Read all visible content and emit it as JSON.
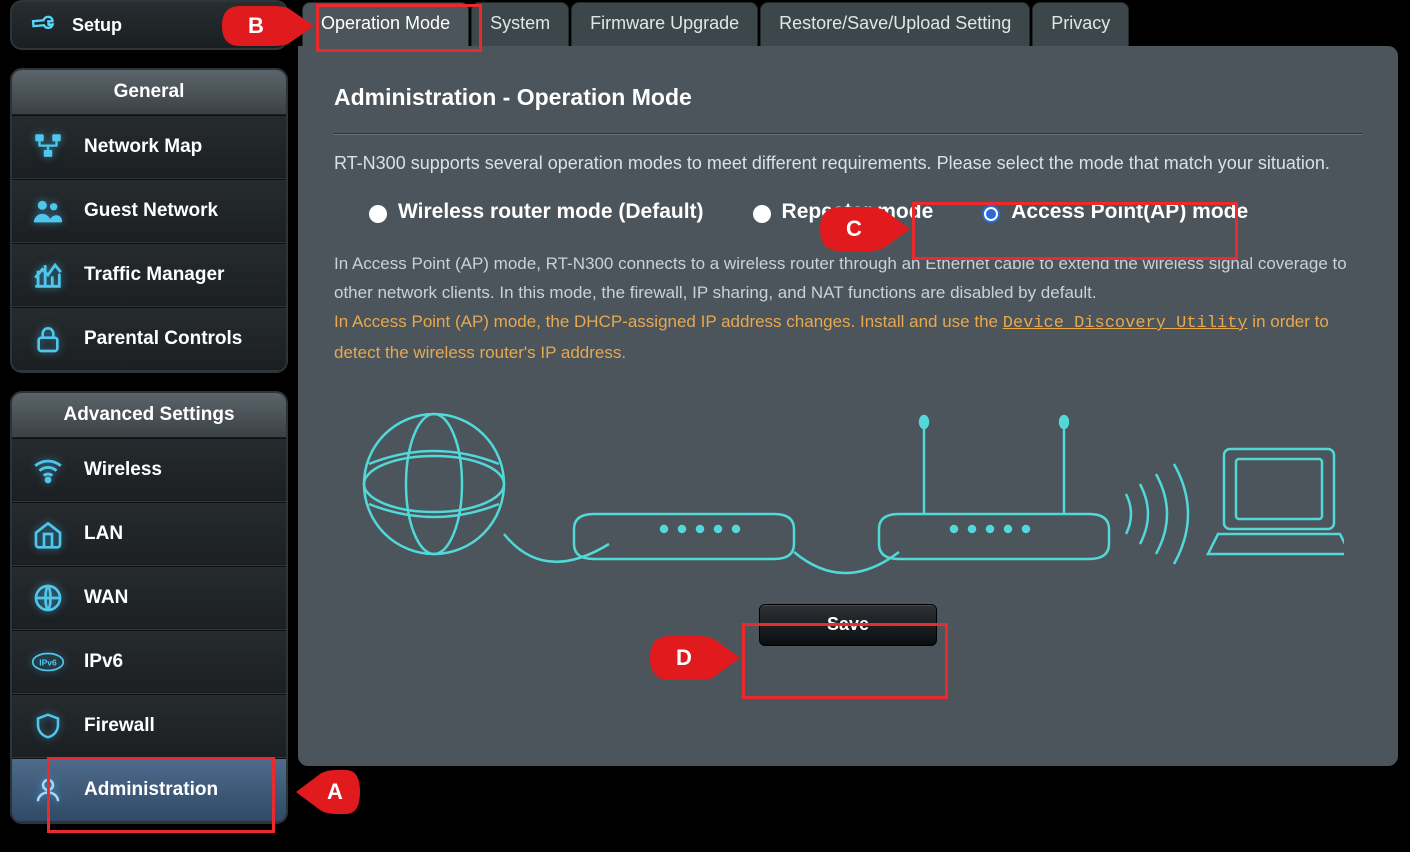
{
  "sidebar": {
    "setup_label": "Setup",
    "general_title": "General",
    "general_items": [
      {
        "label": "Network Map"
      },
      {
        "label": "Guest Network"
      },
      {
        "label": "Traffic Manager"
      },
      {
        "label": "Parental Controls"
      }
    ],
    "advanced_title": "Advanced Settings",
    "advanced_items": [
      {
        "label": "Wireless"
      },
      {
        "label": "LAN"
      },
      {
        "label": "WAN"
      },
      {
        "label": "IPv6"
      },
      {
        "label": "Firewall"
      },
      {
        "label": "Administration"
      }
    ]
  },
  "tabs": [
    {
      "label": "Operation Mode",
      "active": true
    },
    {
      "label": "System"
    },
    {
      "label": "Firmware Upgrade"
    },
    {
      "label": "Restore/Save/Upload Setting"
    },
    {
      "label": "Privacy"
    }
  ],
  "page": {
    "title": "Administration - Operation Mode",
    "intro": "RT-N300 supports several operation modes to meet different requirements. Please select the mode that match your situation.",
    "radios": {
      "r1": "Wireless router mode (Default)",
      "r2": "Repeater mode",
      "r3": "Access Point(AP) mode"
    },
    "desc_plain": "In Access Point (AP) mode, RT-N300 connects to a wireless router through an Ethernet cable to extend the wireless signal coverage to other network clients. In this mode, the firewall, IP sharing, and NAT functions are disabled by default.",
    "desc_warn_pre": "In Access Point (AP) mode, the DHCP-assigned IP address changes. Install and use the ",
    "desc_link": "Device Discovery Utility",
    "desc_warn_post": " in order to detect the wireless router's IP address.",
    "save_label": "Save"
  },
  "callouts": {
    "A": "A",
    "B": "B",
    "C": "C",
    "D": "D"
  }
}
